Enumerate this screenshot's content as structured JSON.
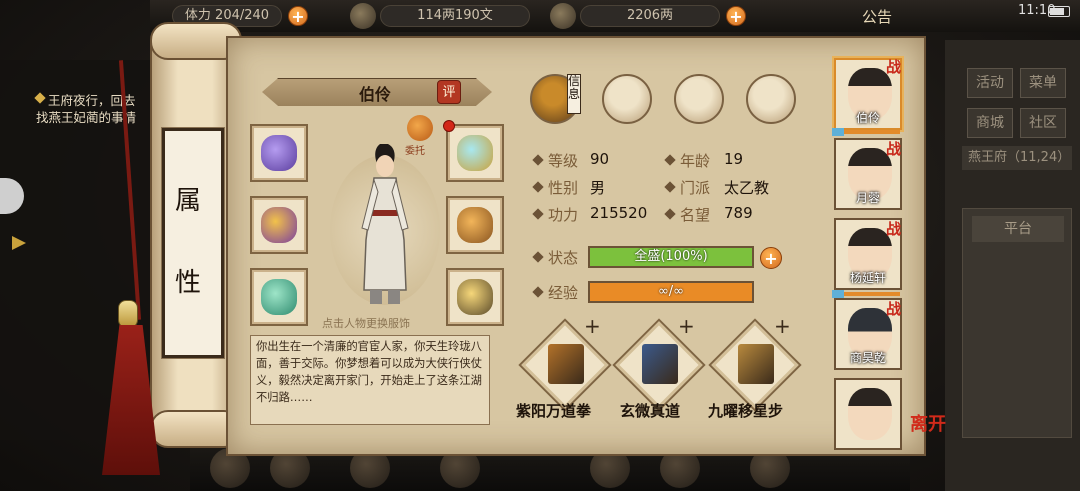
{
  "hud": {
    "stamina": "体力 204/240",
    "silver": "114两190文",
    "gold": "2206两",
    "notice": "公告",
    "time": "11:10"
  },
  "quest": {
    "text": "王府夜行，回去找燕王妃蔺的事情"
  },
  "scroll": {
    "title_1": "属",
    "title_2": "性"
  },
  "character": {
    "name": "伯伶",
    "rate_badge": "评",
    "commission_label": "委托",
    "outfit_tip": "点击人物更换服饰",
    "description": "你出生在一个清廉的官宦人家，你天生玲珑八面，善于交际。你梦想着可以成为大侠行侠仗义，毅然决定离开家门，开始走上了这条江湖不归路……"
  },
  "tabs": {
    "info_label": "信息"
  },
  "stats": {
    "level": {
      "label": "等级",
      "value": "90"
    },
    "age": {
      "label": "年龄",
      "value": "19"
    },
    "gender": {
      "label": "性别",
      "value": "男"
    },
    "sect": {
      "label": "门派",
      "value": "太乙教"
    },
    "power": {
      "label": "功力",
      "value": "215520"
    },
    "fame": {
      "label": "名望",
      "value": "789"
    }
  },
  "status": {
    "label": "状态",
    "text": "全盛(100%)",
    "fraction": 1.0,
    "color": "#7cc13d"
  },
  "experience": {
    "label": "经验",
    "text": "∞/∞",
    "fraction": 1.0,
    "color": "#e98b26"
  },
  "skills": [
    {
      "name": "紫阳万道拳",
      "plus": "+",
      "color": "#b3722a"
    },
    {
      "name": "玄微真道",
      "plus": "+",
      "color": "#3b5a8c"
    },
    {
      "name": "九曜移星步",
      "plus": "+",
      "color": "#b98a3e"
    }
  ],
  "team": [
    {
      "name": "伯伶",
      "badge": "战",
      "selected": true
    },
    {
      "name": "月蓉",
      "badge": "战",
      "selected": false
    },
    {
      "name": "杨延轩",
      "badge": "战",
      "selected": false
    },
    {
      "name": "商昊乾",
      "badge": "战",
      "selected": false
    },
    {
      "name": "",
      "badge": "",
      "selected": false
    }
  ],
  "leave_label": "离开",
  "right_menu": {
    "activity": "活动",
    "menu": "菜单",
    "shop": "商城",
    "community": "社区",
    "location": "燕王府（11,24）",
    "platform": "平台"
  }
}
